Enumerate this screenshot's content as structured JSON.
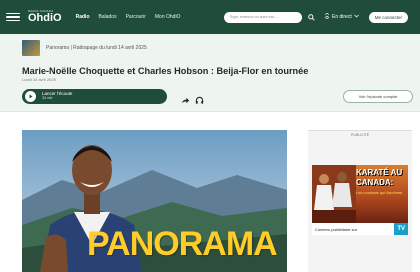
{
  "header": {
    "logo_sub": "RADIO-CANADA",
    "logo_main": "OhdiO",
    "nav": [
      "Radio",
      "Balados",
      "Parcourir",
      "Mon OhdiO"
    ],
    "search_placeholder": "Sujet, émission ou autre mot-…",
    "live_label": "En direct",
    "connect_label": "Me connecter"
  },
  "episode": {
    "breadcrumb": "Panorama  |  Rattrapage du lundi 14 avril 2025",
    "title": "Marie-Noëlle Choquette et Charles Hobson : Beija-Flor en tournée",
    "date": "Lundi 14 avril 2025",
    "listen_label": "Lancer l'écoute",
    "duration": "33 min",
    "full_episode_label": "Voir l'épisode complet"
  },
  "hero": {
    "title": "PANORAMA"
  },
  "ad": {
    "label": "PUBLICITÉ",
    "headline1": "KARATÉ AU",
    "headline2": "CANADA:",
    "tagline": "Les combats qui fascinent",
    "footer": "Contenu publicitaire sur",
    "network": "TV"
  },
  "colors": {
    "brand": "#1f4d3a",
    "accent": "#ffcc2a"
  }
}
